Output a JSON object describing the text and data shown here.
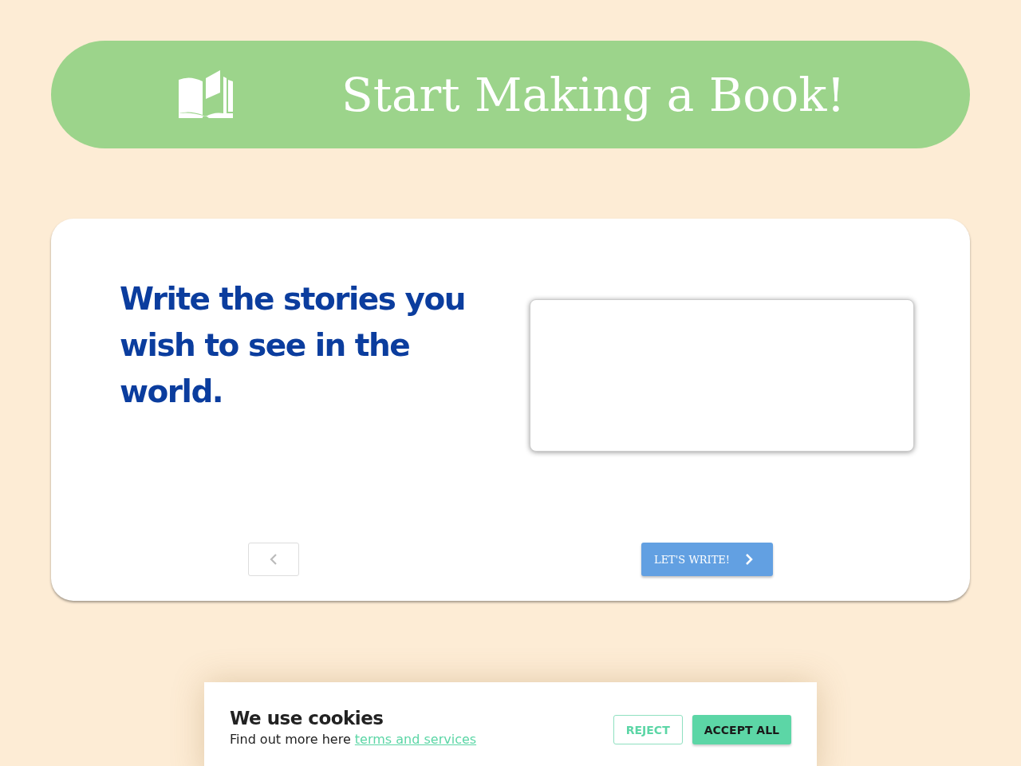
{
  "header": {
    "title": "Start Making a Book!"
  },
  "card": {
    "heading": "Write the stories you wish to see in the world.",
    "back_button": {
      "disabled": true
    },
    "next_button": {
      "label": "LET'S WRITE!"
    }
  },
  "cookie_banner": {
    "title": "We use cookies",
    "text": "Find out more here",
    "link": "terms and services",
    "buttons": [
      {
        "label": "REJECT",
        "kind": "outline"
      },
      {
        "label": "ACCEPT ALL",
        "kind": "filled"
      }
    ]
  }
}
